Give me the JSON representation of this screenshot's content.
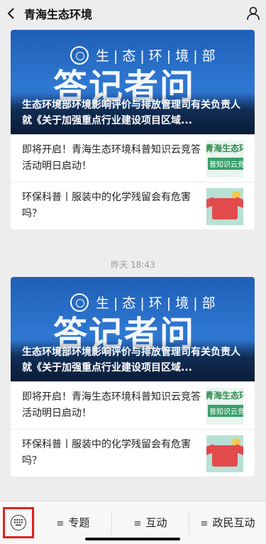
{
  "header": {
    "title": "青海生态环境"
  },
  "messages": [
    {
      "banner": {
        "logo_text": "生|态|环|境|部",
        "big_text": "答记者问",
        "headline": "生态环境部环境影响评价与排放管理司有关负责人就《关于加强重点行业建设项目区域..."
      },
      "items": [
        {
          "text": "即将开启！青海生态环境科普知识云竞答活动明日启动！",
          "thumb": "quiz",
          "thumb_text1": "青海生态环",
          "thumb_text2": "普知识云竞"
        },
        {
          "text": "环保科普丨服装中的化学残留会有危害吗？",
          "thumb": "shirt"
        }
      ]
    },
    {
      "timestamp": "昨天 18:43",
      "banner": {
        "logo_text": "生|态|环|境|部",
        "big_text": "答记者问",
        "headline": "生态环境部环境影响评价与排放管理司有关负责人就《关于加强重点行业建设项目区域..."
      },
      "items": [
        {
          "text": "即将开启！青海生态环境科普知识云竞答活动明日启动！",
          "thumb": "quiz",
          "thumb_text1": "青海生态环",
          "thumb_text2": "普知识云竞"
        },
        {
          "text": "环保科普丨服装中的化学残留会有危害吗？",
          "thumb": "shirt"
        }
      ]
    }
  ],
  "bottom_menu": [
    {
      "label": "专题"
    },
    {
      "label": "互动"
    },
    {
      "label": "政民互动"
    }
  ],
  "icons": {
    "back": "chevron-left-icon",
    "profile": "person-icon",
    "keyboard": "keyboard-icon",
    "menu": "menu-lines-icon"
  }
}
